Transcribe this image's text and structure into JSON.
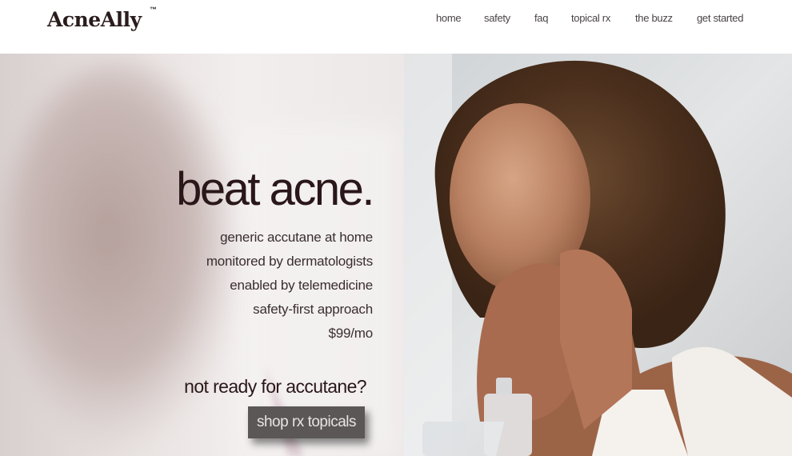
{
  "brand": {
    "name": "AcneAlly",
    "trademark": "™"
  },
  "nav": {
    "items": [
      {
        "label": "home"
      },
      {
        "label": "safety"
      },
      {
        "label": "faq"
      },
      {
        "label": "topical rx"
      },
      {
        "label": "the buzz"
      },
      {
        "label": "get started"
      }
    ]
  },
  "hero": {
    "headline": "beat acne.",
    "features": [
      "generic accutane at home",
      "monitored by dermatologists",
      "enabled by telemedicine",
      "safety-first approach",
      "$99/mo"
    ],
    "subhead": "not ready for accutane?",
    "cta_label": "shop rx topicals"
  },
  "colors": {
    "text_dark": "#2a1719",
    "nav_text": "#4a4446",
    "cta_bg": "#5b5757",
    "cta_text": "#e7e4e5"
  }
}
